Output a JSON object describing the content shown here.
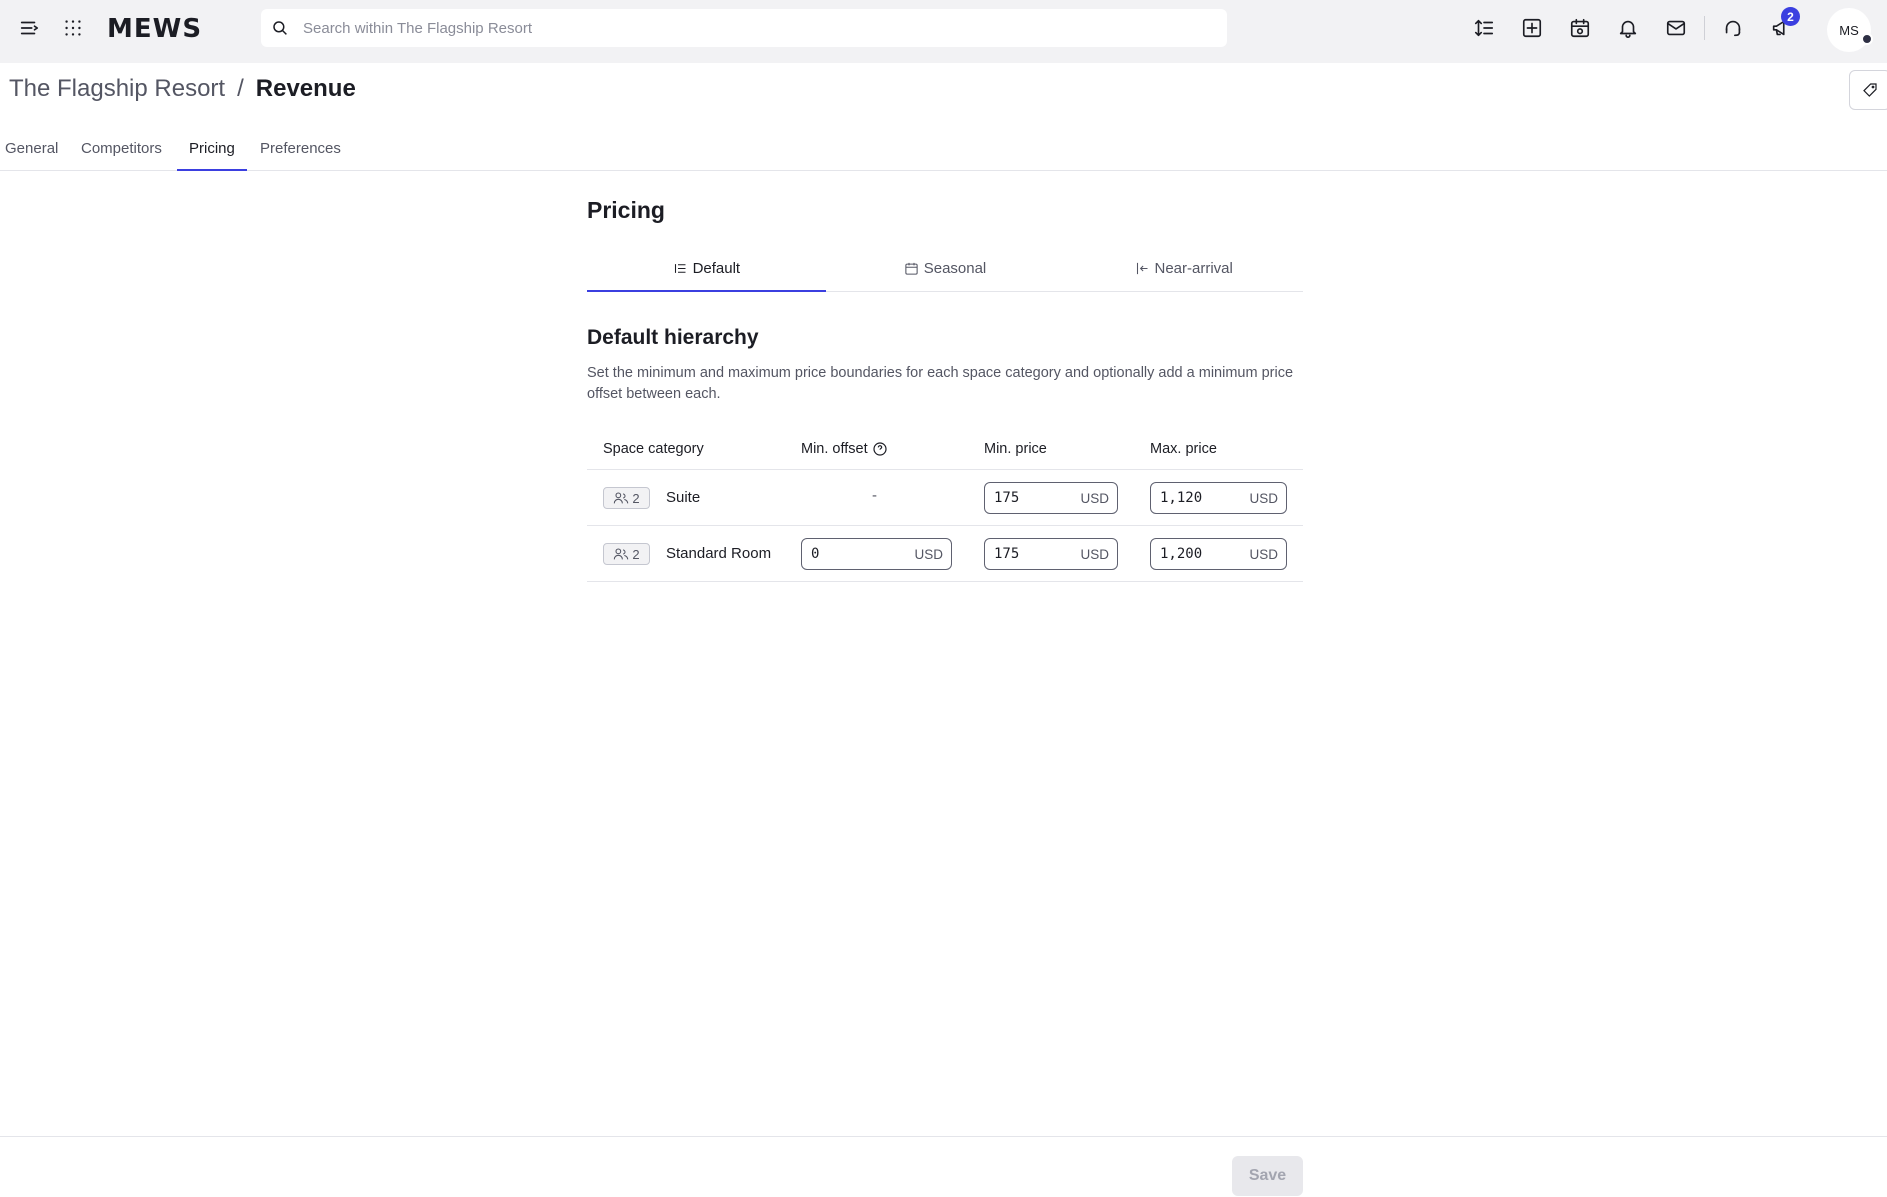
{
  "topbar": {
    "logo": "MEWS",
    "search_placeholder": "Search within The Flagship Resort",
    "notifications_badge": "2",
    "user_initials": "MS"
  },
  "header": {
    "breadcrumb_parent": "The Flagship Resort",
    "breadcrumb_separator": "/",
    "breadcrumb_current": "Revenue"
  },
  "main_tabs": [
    {
      "label": "General",
      "active": false
    },
    {
      "label": "Competitors",
      "active": false
    },
    {
      "label": "Pricing",
      "active": true
    },
    {
      "label": "Preferences",
      "active": false
    }
  ],
  "content": {
    "title": "Pricing",
    "sub_tabs": [
      {
        "label": "Default",
        "icon": "list-icon",
        "active": true
      },
      {
        "label": "Seasonal",
        "icon": "calendar-icon",
        "active": false
      },
      {
        "label": "Near-arrival",
        "icon": "arrival-icon",
        "active": false
      }
    ],
    "section_title": "Default hierarchy",
    "section_description": "Set the minimum and maximum price boundaries for each space category and optionally add a minimum price offset between each."
  },
  "table": {
    "columns": [
      "Space category",
      "Min. offset",
      "Min. price",
      "Max. price"
    ],
    "rows": [
      {
        "capacity": "2",
        "category": "Suite",
        "min_offset": "-",
        "min_offset_editable": false,
        "min_price": "175",
        "max_price": "1,120",
        "currency": "USD"
      },
      {
        "capacity": "2",
        "category": "Standard Room",
        "min_offset": "0",
        "min_offset_editable": true,
        "min_price": "175",
        "max_price": "1,200",
        "currency": "USD"
      }
    ]
  },
  "footer": {
    "save_label": "Save"
  },
  "colors": {
    "accent": "#3b3fe0",
    "topbar_bg": "#f2f2f4"
  }
}
